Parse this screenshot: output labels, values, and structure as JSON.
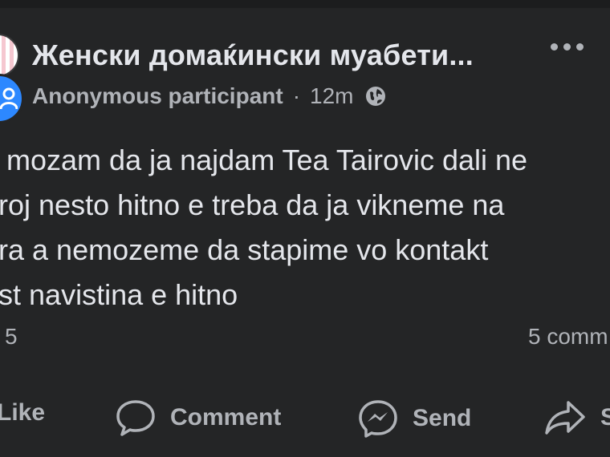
{
  "post": {
    "group_name": "Женски домаќински муабети...",
    "author": "Anonymous participant",
    "separator": "·",
    "time": "12m",
    "privacy_icon": "globe-icon",
    "body_lines": [
      "e mozam da ja najdam Tea Tairovic dali ne",
      "proj nesto hitno e treba da ja vikneme na",
      "ura a nemozeme da stapime vo kontakt",
      "ost navistina e hitno"
    ],
    "reactions_count": "5",
    "comments_count": "5 comm"
  },
  "actions": {
    "like": "Like",
    "comment": "Comment",
    "send": "Send",
    "share": "S"
  },
  "colors": {
    "background": "#242526",
    "primary_text": "#e4e6eb",
    "secondary_text": "#b0b3b8",
    "badge_blue": "#2d88ff"
  }
}
